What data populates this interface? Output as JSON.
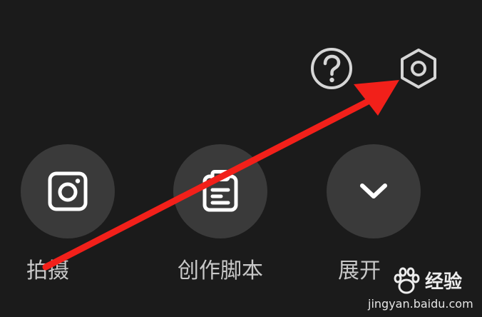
{
  "top_bar": {
    "help_icon": "question-circle-icon",
    "settings_icon": "hexagon-gear-icon"
  },
  "actions": [
    {
      "label": "拍摄",
      "icon": "camera-icon"
    },
    {
      "label": "创作脚本",
      "icon": "script-document-icon"
    },
    {
      "label": "展开",
      "icon": "chevron-down-icon"
    }
  ],
  "annotation": {
    "arrow_color": "#f2201a"
  },
  "watermark": {
    "brand_cn": "经验",
    "url": "jingyan.baidu.com"
  },
  "colors": {
    "background": "#1b1b1b",
    "button_circle": "#3a3a3a",
    "icon_stroke": "#ffffff",
    "label_text": "#c8c8c8"
  }
}
